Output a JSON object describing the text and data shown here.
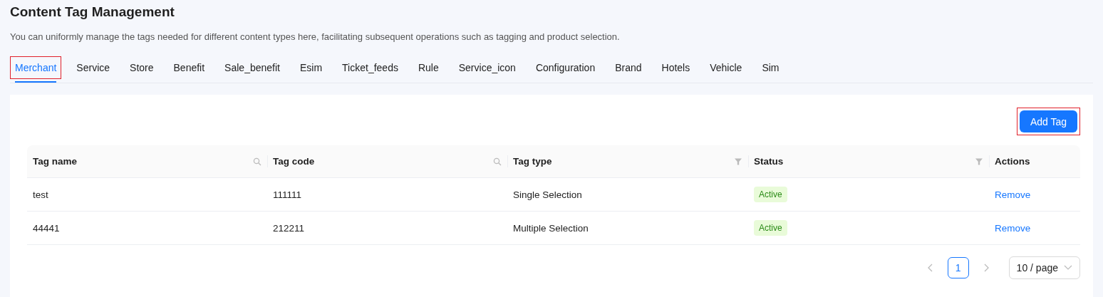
{
  "page": {
    "title": "Content Tag Management",
    "description": "You can uniformly manage the tags needed for different content types here, facilitating subsequent operations such as tagging and product selection."
  },
  "tabs": [
    {
      "label": "Merchant",
      "selected": true,
      "highlighted": true
    },
    {
      "label": "Service",
      "selected": false,
      "highlighted": false
    },
    {
      "label": "Store",
      "selected": false,
      "highlighted": false
    },
    {
      "label": "Benefit",
      "selected": false,
      "highlighted": false
    },
    {
      "label": "Sale_benefit",
      "selected": false,
      "highlighted": false
    },
    {
      "label": "Esim",
      "selected": false,
      "highlighted": false
    },
    {
      "label": "Ticket_feeds",
      "selected": false,
      "highlighted": false
    },
    {
      "label": "Rule",
      "selected": false,
      "highlighted": false
    },
    {
      "label": "Service_icon",
      "selected": false,
      "highlighted": false
    },
    {
      "label": "Configuration",
      "selected": false,
      "highlighted": false
    },
    {
      "label": "Brand",
      "selected": false,
      "highlighted": false
    },
    {
      "label": "Hotels",
      "selected": false,
      "highlighted": false
    },
    {
      "label": "Vehicle",
      "selected": false,
      "highlighted": false
    },
    {
      "label": "Sim",
      "selected": false,
      "highlighted": false
    }
  ],
  "add_button": {
    "label": "Add Tag",
    "highlighted": true
  },
  "table": {
    "columns": [
      {
        "label": "Tag name",
        "kind": "search"
      },
      {
        "label": "Tag code",
        "kind": "search"
      },
      {
        "label": "Tag type",
        "kind": "filter"
      },
      {
        "label": "Status",
        "kind": "filter"
      },
      {
        "label": "Actions",
        "kind": "plain"
      }
    ],
    "rows": [
      {
        "name": "test",
        "code": "111111",
        "type": "Single Selection",
        "status": "Active",
        "action": "Remove"
      },
      {
        "name": "44441",
        "code": "212211",
        "type": "Multiple Selection",
        "status": "Active",
        "action": "Remove"
      }
    ]
  },
  "pagination": {
    "pages": [
      {
        "label": "1",
        "selected": true
      }
    ],
    "page_size": "10 / page"
  }
}
